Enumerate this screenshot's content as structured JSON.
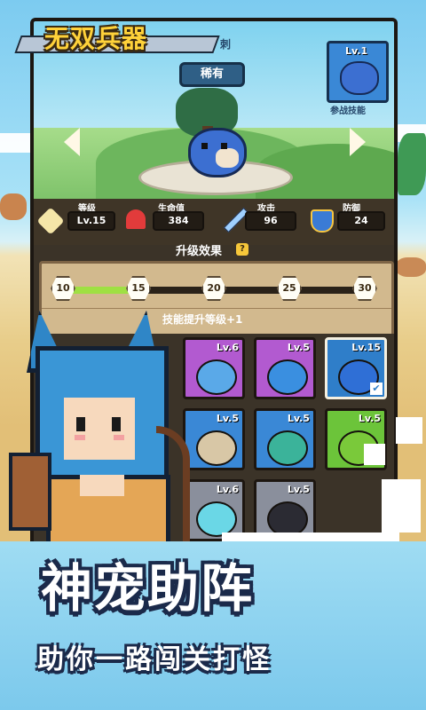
{
  "header": {
    "title": "无双兵器",
    "rarity": "稀有",
    "title_suffix": "刺"
  },
  "pet_slot": {
    "level": "Lv.1",
    "label": "参战技能"
  },
  "stats": [
    {
      "label": "等级",
      "value": "Lv.15",
      "icon": "level-badge-icon",
      "color": "#f5e6a8"
    },
    {
      "label": "生命值",
      "value": "384",
      "icon": "heart-icon",
      "color": "#e23b3b"
    },
    {
      "label": "攻击",
      "value": "96",
      "icon": "sword-icon",
      "color": "#9fd0ff"
    },
    {
      "label": "防御",
      "value": "24",
      "icon": "shield-icon",
      "color": "#3a7bd5"
    }
  ],
  "upgrade": {
    "title": "升级效果",
    "help": "?",
    "milestones": [
      "10",
      "15",
      "20",
      "25",
      "30"
    ],
    "progress_fraction": 0.25,
    "skill_text": "技能提升等级+1"
  },
  "pets": [
    {
      "level": "Lv.6",
      "bg": "#b25ad0",
      "pet": "hedgehog",
      "color": "#5aa9e8"
    },
    {
      "level": "Lv.5",
      "bg": "#b25ad0",
      "pet": "mushroom",
      "color": "#3a8fe0"
    },
    {
      "level": "Lv.15",
      "bg": "#2f7ec9",
      "pet": "blowfish",
      "color": "#2f6fd6",
      "selected": true
    },
    {
      "level": "Lv.5",
      "bg": "#3a88d6",
      "pet": "owl",
      "color": "#d8c7a6"
    },
    {
      "level": "Lv.5",
      "bg": "#3a88d6",
      "pet": "mushroom",
      "color": "#3bb39a"
    },
    {
      "level": "Lv.5",
      "bg": "#6cc43a",
      "pet": "frog",
      "color": "#7ac93a"
    },
    {
      "level": "Lv.6",
      "bg": "#8a8f9c",
      "pet": "slime",
      "color": "#6ad7e6"
    },
    {
      "level": "Lv.5",
      "bg": "#8a8f9c",
      "pet": "crow",
      "color": "#2b2b33"
    }
  ],
  "slogan": {
    "line1": "神宠助阵",
    "line2": "助你一路闯关打怪"
  },
  "colors": {
    "panel": "#3b3328",
    "accent": "#ffd23a",
    "outline": "#1b2a4a"
  }
}
